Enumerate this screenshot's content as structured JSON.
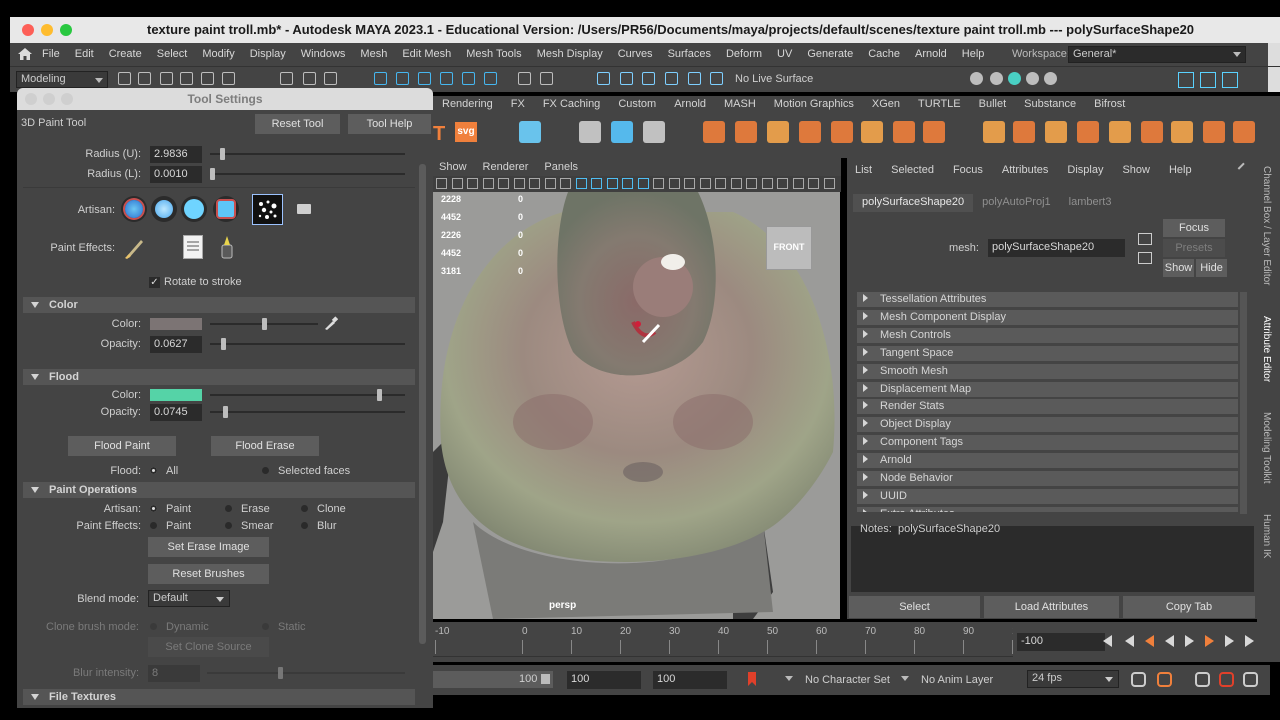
{
  "window": {
    "title": "texture paint troll.mb* - Autodesk MAYA 2023.1 - Educational Version: /Users/PR56/Documents/maya/projects/default/scenes/texture paint troll.mb  ---  polySurfaceShape20"
  },
  "menubar": {
    "items": [
      "File",
      "Edit",
      "Create",
      "Select",
      "Modify",
      "Display",
      "Windows",
      "Mesh",
      "Edit Mesh",
      "Mesh Tools",
      "Mesh Display",
      "Curves",
      "Surfaces",
      "Deform",
      "UV",
      "Generate",
      "Cache",
      "Arnold",
      "Help"
    ],
    "workspace_label": "Workspace:",
    "workspace_value": "General*"
  },
  "statusline": {
    "mode": "Modeling",
    "live_surface": "No Live Surface"
  },
  "shelf": {
    "tabs": [
      "Rendering",
      "FX",
      "FX Caching",
      "Custom",
      "Arnold",
      "MASH",
      "Motion Graphics",
      "XGen",
      "TURTLE",
      "Bullet",
      "Substance",
      "Bifrost"
    ],
    "svg_label": "svg"
  },
  "tool_settings": {
    "title": "Tool Settings",
    "tool_name": "3D Paint Tool",
    "reset_tool": "Reset Tool",
    "tool_help": "Tool Help",
    "radius_u_label": "Radius (U):",
    "radius_u_value": "2.9836",
    "radius_u_fraction": 0.05,
    "radius_l_label": "Radius (L):",
    "radius_l_value": "0.0010",
    "radius_l_fraction": 0.0,
    "artisan_label": "Artisan:",
    "paint_effects_label": "Paint Effects:",
    "rotate_to_stroke": "Rotate to stroke",
    "rotate_to_stroke_checked": true,
    "color_section": "Color",
    "color_label": "Color:",
    "color_swatch": "#7c7474",
    "color_fraction": 0.5,
    "opacity_label": "Opacity:",
    "color_opacity": "0.0627",
    "color_opacity_fraction": 0.06,
    "flood_section": "Flood",
    "flood_color_label": "Color:",
    "flood_swatch": "#55d3a7",
    "flood_color_fraction": 0.88,
    "flood_opacity_label": "Opacity:",
    "flood_opacity": "0.0745",
    "flood_opacity_fraction": 0.07,
    "flood_paint": "Flood Paint",
    "flood_erase": "Flood Erase",
    "flood_label": "Flood:",
    "flood_all": "All",
    "flood_selected": "Selected faces",
    "paint_ops_section": "Paint Operations",
    "artisan2_label": "Artisan:",
    "op_paint": "Paint",
    "op_erase": "Erase",
    "op_clone": "Clone",
    "pe_label": "Paint Effects:",
    "pe_paint": "Paint",
    "pe_smear": "Smear",
    "pe_blur": "Blur",
    "set_erase_image": "Set Erase Image",
    "reset_brushes": "Reset Brushes",
    "blend_mode_label": "Blend mode:",
    "blend_mode_value": "Default",
    "clone_mode_label": "Clone brush mode:",
    "clone_dynamic": "Dynamic",
    "clone_static": "Static",
    "set_clone_source": "Set Clone Source",
    "blur_intensity_label": "Blur intensity:",
    "blur_intensity_value": "8",
    "file_textures_section": "File Textures"
  },
  "viewport": {
    "menu": [
      "Show",
      "Renderer",
      "Panels"
    ],
    "hud_rows": [
      [
        "2228",
        "0"
      ],
      [
        "4452",
        "0"
      ],
      [
        "2226",
        "0"
      ],
      [
        "4452",
        "0"
      ],
      [
        "3181",
        "0"
      ]
    ],
    "cube_label": "FRONT",
    "camera": "persp"
  },
  "attribute_editor": {
    "menu": [
      "List",
      "Selected",
      "Focus",
      "Attributes",
      "Display",
      "Show",
      "Help"
    ],
    "tabs": [
      "polySurfaceShape20",
      "polyAutoProj1",
      "lambert3"
    ],
    "mesh_label": "mesh:",
    "mesh_value": "polySurfaceShape20",
    "focus": "Focus",
    "presets": "Presets",
    "show": "Show",
    "hide": "Hide",
    "sections": [
      "Tessellation Attributes",
      "Mesh Component Display",
      "Mesh Controls",
      "Tangent Space",
      "Smooth Mesh",
      "Displacement Map",
      "Render Stats",
      "Object Display",
      "Component Tags",
      "Arnold",
      "Node Behavior",
      "UUID",
      "Extra Attributes"
    ],
    "notes_label": "Notes:",
    "notes_value": "polySurfaceShape20",
    "select": "Select",
    "load_attributes": "Load Attributes",
    "copy_tab": "Copy Tab"
  },
  "side_tabs": [
    "Channel Box / Layer Editor",
    "Attribute Editor",
    "Modeling Toolkit",
    "Human IK"
  ],
  "timeline": {
    "ticks": [
      "-10",
      "0",
      "10",
      "20",
      "30",
      "40",
      "50",
      "60",
      "70",
      "80",
      "90",
      "10"
    ],
    "current_frame": "-100"
  },
  "range": {
    "start_slider": "100",
    "start": "100",
    "end": "100",
    "character_set": "No Character Set",
    "anim_layer": "No Anim Layer",
    "fps": "24 fps"
  }
}
